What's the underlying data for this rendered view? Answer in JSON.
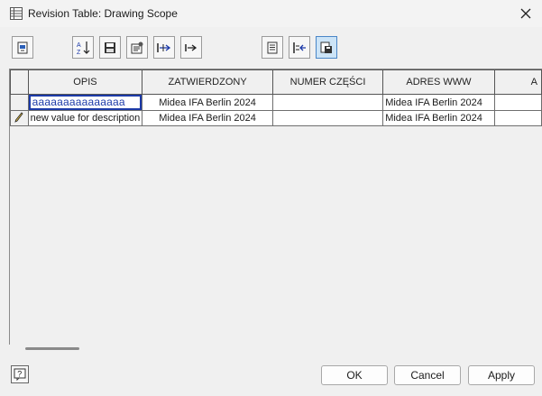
{
  "window": {
    "title": "Revision Table: Drawing Scope"
  },
  "toolbar": {
    "buttons": [
      {
        "icon": "insert-row-icon"
      },
      {
        "icon": "sort-az-icon"
      },
      {
        "icon": "save-table-icon"
      },
      {
        "icon": "properties-icon"
      },
      {
        "icon": "move-column-left-icon"
      },
      {
        "icon": "move-column-right-icon"
      },
      {
        "icon": "document-list-icon"
      },
      {
        "icon": "column-insert-icon"
      },
      {
        "icon": "save-as-icon"
      }
    ]
  },
  "table": {
    "columns": [
      "OPIS",
      "ZATWIERDZONY",
      "NUMER CZĘŚCI",
      "ADRES WWW",
      "A"
    ],
    "rows": [
      {
        "cells": [
          "aaaaaaaaaaaaaaa",
          "Midea IFA Berlin 2024",
          "",
          "Midea IFA Berlin 2024",
          ""
        ],
        "editing": true
      },
      {
        "cells": [
          "new value for description",
          "Midea IFA Berlin 2024",
          "",
          "Midea IFA Berlin 2024",
          ""
        ],
        "pencil": true
      }
    ]
  },
  "footer": {
    "ok_label": "OK",
    "cancel_label": "Cancel",
    "apply_label": "Apply"
  },
  "colors": {
    "accent": "#1c3aa8",
    "active_toggle": "#cce4f7"
  }
}
